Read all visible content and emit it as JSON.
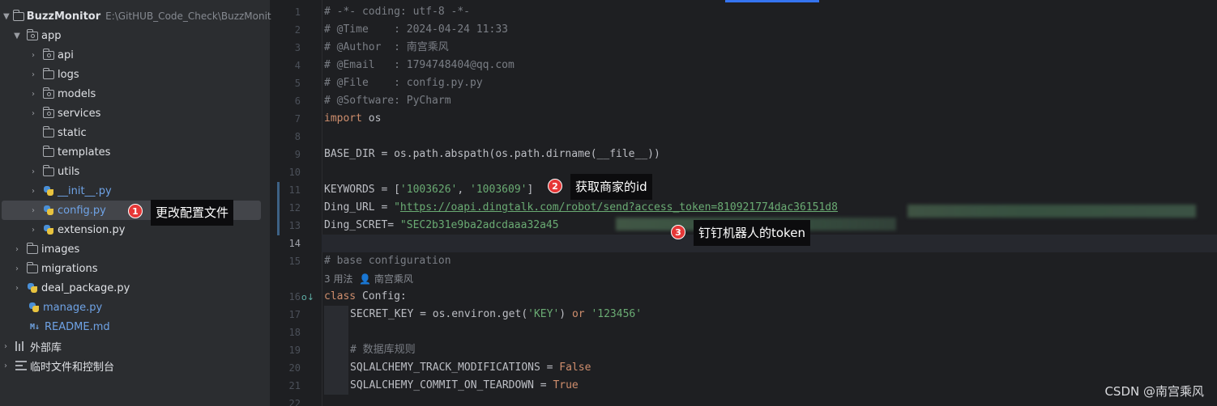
{
  "project": {
    "name": "BuzzMonitor",
    "path": "E:\\GitHUB_Code_Check\\BuzzMonitor",
    "items": [
      {
        "label": "app"
      },
      {
        "label": "api"
      },
      {
        "label": "logs"
      },
      {
        "label": "models"
      },
      {
        "label": "services"
      },
      {
        "label": "static"
      },
      {
        "label": "templates"
      },
      {
        "label": "utils"
      },
      {
        "label": "__init__.py"
      },
      {
        "label": "config.py"
      },
      {
        "label": "extension.py"
      },
      {
        "label": "images"
      },
      {
        "label": "migrations"
      },
      {
        "label": "deal_package.py"
      },
      {
        "label": "manage.py"
      },
      {
        "label": "README.md"
      },
      {
        "label": "外部库"
      },
      {
        "label": "临时文件和控制台"
      }
    ],
    "md_badge": "M↓"
  },
  "editor": {
    "line_numbers": [
      "1",
      "2",
      "3",
      "4",
      "5",
      "6",
      "7",
      "8",
      "9",
      "10",
      "11",
      "12",
      "13",
      "14",
      "15",
      "16",
      "17",
      "18",
      "19",
      "20",
      "21",
      "22"
    ],
    "current_line": "14",
    "lines": {
      "l1": "# -*- coding: utf-8 -*-",
      "l2": "# @Time    : 2024-04-24 11:33",
      "l3": "# @Author  : 南宫乘风",
      "l4": "# @Email   : 1794748404@qq.com",
      "l5": "# @File    : config.py.py",
      "l6": "# @Software: PyCharm",
      "l7_kw": "import",
      "l7_rest": " os",
      "l9": "BASE_DIR = os.path.abspath(os.path.dirname(__file__))",
      "l11_a": "KEYWORDS = [",
      "l11_s1": "'1003626'",
      "l11_b": ", ",
      "l11_s2": "'1003609'",
      "l11_c": "]",
      "l12_a": "Ding_URL = ",
      "l12_q": "\"",
      "l12_url": "https://oapi.dingtalk.com/robot/send?access_token=810921774dac36151d8",
      "l13_a": "Ding_SCRET= ",
      "l13_s": "\"SEC2b31e9ba2adcdaaa32a45",
      "l15": "# base configuration",
      "l15_hint_usages": "3 用法",
      "l15_hint_author": "南宫乘风",
      "l16_kw": "class",
      "l16_rest": " Config:",
      "l17_a": "SECRET_KEY = os.environ.get(",
      "l17_s1": "'KEY'",
      "l17_b": ") ",
      "l17_kw": "or",
      "l17_c": " ",
      "l17_s2": "'123456'",
      "l19": "# 数据库规则",
      "l20_a": "SQLALCHEMY_TRACK_MODIFICATIONS = ",
      "l20_kw": "False",
      "l21_a": "SQLALCHEMY_COMMIT_ON_TEARDOWN = ",
      "l21_kw": "True"
    }
  },
  "annotations": [
    {
      "number": "1",
      "text": "更改配置文件"
    },
    {
      "number": "2",
      "text": "获取商家的id"
    },
    {
      "number": "3",
      "text": "钉钉机器人的token"
    }
  ],
  "watermark": "CSDN @南宫乘风",
  "colors": {
    "accent": "#3574f0",
    "badge": "#e63737",
    "keyword": "#cf8e6d",
    "string": "#6aab73",
    "comment": "#7a7e85"
  },
  "icons": [
    "chevron-right-icon",
    "chevron-down-icon",
    "folder-icon",
    "package-folder-icon",
    "python-file-icon",
    "markdown-icon",
    "library-icon",
    "scratch-icon",
    "user-icon",
    "implementation-gutter-icon"
  ]
}
